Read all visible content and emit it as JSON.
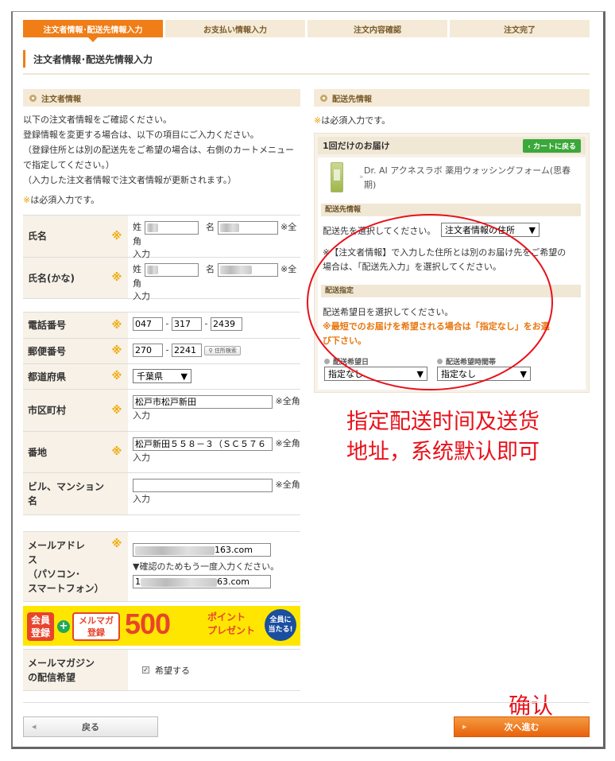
{
  "steps": [
    "注文者情報･配送先情報入力",
    "お支払い情報入力",
    "注文内容確認",
    "注文完了"
  ],
  "page_title": "注文者情報･配送先情報入力",
  "orderer": {
    "section_title": "注文者情報",
    "intro": [
      "以下の注文者情報をご確認ください。",
      "登録情報を変更する場合は、以下の項目にご入力ください。",
      "（登録住所とは別の配送先をご希望の場合は、右側のカートメニュー",
      "で指定してください。）",
      "（入力した注文者情報で注文者情報が更新されます。）"
    ],
    "required_mark": "※",
    "required_note": "は必須入力です。",
    "name_label": "氏名",
    "kana_label": "氏名(かな)",
    "sei": "姓",
    "mei": "名",
    "fullwidth_note_a": "※全角",
    "fullwidth_note_b": "入力",
    "phone_label": "電話番号",
    "phone": [
      "047",
      "317",
      "2439"
    ],
    "dash": "-",
    "zip_label": "郵便番号",
    "zip": [
      "270",
      "2241"
    ],
    "zip_button": "住所検索",
    "pref_label": "都道府県",
    "pref_value": "千葉県",
    "city_label": "市区町村",
    "city_value": "松戸市松戸新田",
    "street_label": "番地",
    "street_value": "松戸新田５５８－３（ＳＣ５７６",
    "building_label": "ビル、マンション名",
    "building_label_1": "ビル、マンション",
    "building_label_2": "名",
    "email_label_1": "メールアドレ",
    "email_label_2": "ス",
    "email_label_3": "（パソコン･",
    "email_label_4": "スマートフォン）",
    "email_value_1": "163.com",
    "email_confirm_note": "▼確認のためもう一度入力ください。",
    "email_value_2_prefix": "1",
    "email_value_2": "63.com",
    "newsletter_label_1": "メールマガジン",
    "newsletter_label_2": "の配信希望",
    "newsletter_checkbox": "希望する"
  },
  "banner": {
    "member_1": "会員",
    "member_2": "登録",
    "mag_1": "メルマガ",
    "mag_2": "登録",
    "points": "500",
    "points_1": "ポイント",
    "points_2": "プレゼント",
    "badge_1": "全員に",
    "badge_2": "当たる!"
  },
  "delivery": {
    "section_title": "配送先情報",
    "required_mark": "※",
    "required_note": "は必須入力です。",
    "box_title": "1回だけのお届け",
    "cart_button": "カートに戻る",
    "product_name": "Dr. AI アクネスラボ 薬用ウォッシングフォーム(思春期)",
    "address_sub_head": "配送先情報",
    "address_prompt": "配送先を選択してください。",
    "address_select": "注文者情報の住所",
    "address_note_1": "※【注文者情報】で入力した住所とは別のお届け先をご希望の",
    "address_note_2": "場合は、「配送先入力」を選択してください。",
    "schedule_sub_head": "配送指定",
    "date_prompt": "配送希望日を選択してください。",
    "warning_1": "※最短でのお届けを希望される場合は「指定なし」をお選",
    "warning_2": "び下さい。",
    "date_label": "配送希望日",
    "time_label": "配送希望時間帯",
    "date_value": "指定なし",
    "time_value": "指定なし"
  },
  "annotations": {
    "line1": "指定配送时间及送货",
    "line2": "地址，系统默认即可",
    "confirm": "确认"
  },
  "buttons": {
    "back": "戻る",
    "next": "次へ進む"
  }
}
